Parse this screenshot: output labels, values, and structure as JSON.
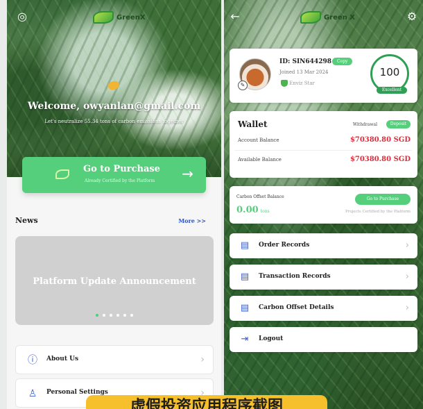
{
  "colors": {
    "accent": "#55cf7b",
    "link": "#2a52c8",
    "amount": "#e02a3a",
    "menu_icon": "#3a5ccc"
  },
  "left": {
    "brand": "GreenX",
    "welcome_title": "Welcome, owyanlan@gmail.com",
    "welcome_sub": "Let's neutralize 55.34 tons of carbon emissions together",
    "purchase": {
      "title": "Go to Purchase",
      "subtitle": "Already Certified by the Platform"
    },
    "news": {
      "heading": "News",
      "more": "More >>"
    },
    "banner": {
      "title": "Platform Update Announcement",
      "dots": 6,
      "active_dot": 1
    },
    "menu": [
      {
        "label": "About Us",
        "icon": "info-circle-icon"
      },
      {
        "label": "Personal Settings",
        "icon": "user-settings-icon"
      }
    ]
  },
  "right": {
    "brand": "Green X",
    "profile": {
      "id": "ID: SIN644298",
      "copy": "Copy",
      "joined": "Joined 13 Mar 2024",
      "badge": "Enviz Star",
      "score": "100",
      "level": "Excellent"
    },
    "wallet": {
      "title": "Wallet",
      "withdrawal": "Withdrawal",
      "deposit": "Deposit",
      "account_label": "Account Balance",
      "account_value": "$70380.80 SGD",
      "available_label": "Available Balance",
      "available_value": "$70380.80 SGD"
    },
    "offset": {
      "label": "Carbon Offset Balance",
      "value": "0.00",
      "unit": "tons",
      "button": "Go to Purchase",
      "note": "Projects Certified by the Platform"
    },
    "menu": [
      {
        "label": "Order Records",
        "icon": "document-icon"
      },
      {
        "label": "Transaction Records",
        "icon": "list-icon"
      },
      {
        "label": "Carbon Offset Details",
        "icon": "ledger-icon"
      },
      {
        "label": "Logout",
        "icon": "logout-icon"
      }
    ]
  },
  "watermark": "虚假投资应用程序截图"
}
